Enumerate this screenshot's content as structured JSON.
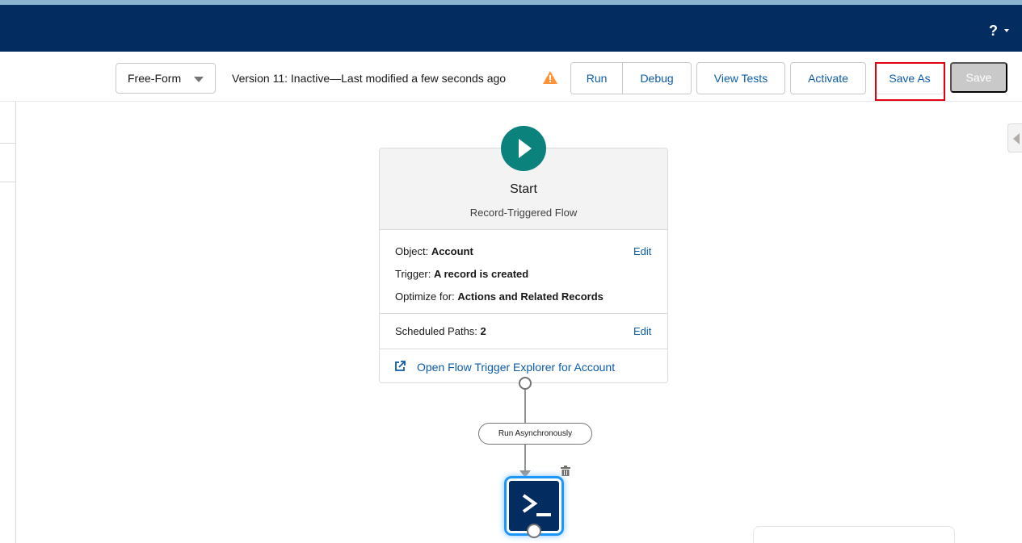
{
  "header": {
    "help_label": "?"
  },
  "toolbar": {
    "layout_select": "Free-Form",
    "version_status": "Version 11: Inactive—Last modified a few seconds ago",
    "run_label": "Run",
    "debug_label": "Debug",
    "view_tests_label": "View Tests",
    "activate_label": "Activate",
    "save_as_label": "Save As",
    "save_label": "Save"
  },
  "start_node": {
    "title": "Start",
    "subtitle": "Record-Triggered Flow",
    "object_label": "Object:",
    "object_value": "Account",
    "trigger_label": "Trigger:",
    "trigger_value": "A record is created",
    "optimize_label": "Optimize for:",
    "optimize_value": "Actions and Related Records",
    "scheduled_label": "Scheduled Paths:",
    "scheduled_value": "2",
    "edit_label": "Edit",
    "explorer_link": "Open Flow Trigger Explorer for Account"
  },
  "path": {
    "pill_label": "Run Asynchronously"
  },
  "colors": {
    "header_bg": "#032d60",
    "link": "#0b5cab",
    "start_green": "#0b827c",
    "highlight_red": "#e3000f",
    "warning": "#fe9339"
  },
  "icons": {
    "help": "question-icon",
    "warning": "warning-triangle-icon",
    "start": "play-icon",
    "external": "external-link-icon",
    "delete": "trash-icon",
    "action": "terminal-prompt-icon"
  }
}
